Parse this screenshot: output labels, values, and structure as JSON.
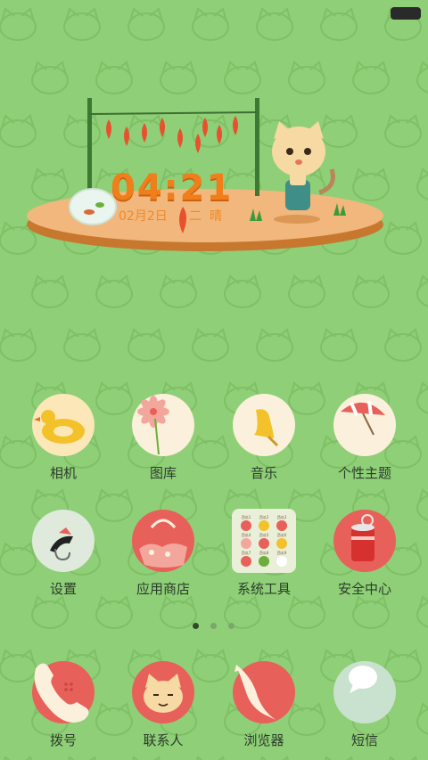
{
  "clock": {
    "time": "04:21",
    "date": "02月2日",
    "weekday": "二",
    "weather": "晴"
  },
  "apps": [
    {
      "label": "相机",
      "icon": "duck-float-icon"
    },
    {
      "label": "图库",
      "icon": "flower-icon"
    },
    {
      "label": "音乐",
      "icon": "bell-icon"
    },
    {
      "label": "个性主题",
      "icon": "umbrella-icon"
    },
    {
      "label": "设置",
      "icon": "fishing-hook-icon"
    },
    {
      "label": "应用商店",
      "icon": "shopping-bag-icon"
    },
    {
      "label": "系统工具",
      "icon": "app-folder-icon"
    },
    {
      "label": "安全中心",
      "icon": "tin-can-icon"
    }
  ],
  "dock": [
    {
      "label": "拨号",
      "icon": "phone-icon"
    },
    {
      "label": "联系人",
      "icon": "cat-face-icon"
    },
    {
      "label": "浏览器",
      "icon": "fish-icon"
    },
    {
      "label": "短信",
      "icon": "speech-bubble-icon"
    }
  ],
  "folder_mini_labels": [
    "西瓜1",
    "西瓜2",
    "西瓜3",
    "西瓜4",
    "西瓜5",
    "西瓜6",
    "西瓜7",
    "西瓜8",
    "西瓜9"
  ],
  "pager": {
    "pages": 3,
    "current": 1
  },
  "colors": {
    "background": "#8fcf77",
    "accent_red": "#e85a4f",
    "clock_orange": "#f07f1b"
  }
}
